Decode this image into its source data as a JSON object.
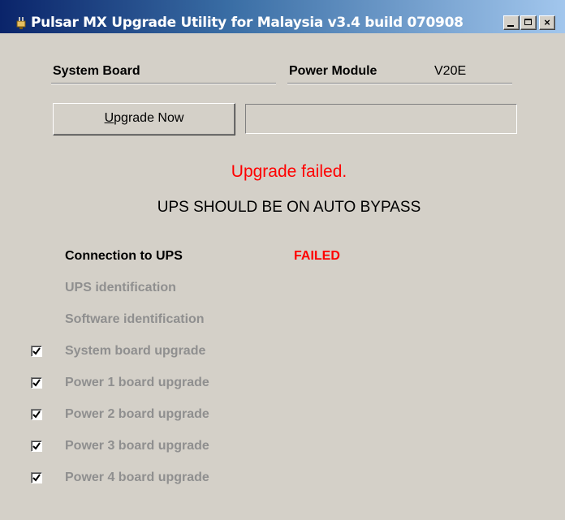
{
  "window": {
    "title": "Pulsar MX Upgrade Utility for Malaysia v3.4 build 070908"
  },
  "header": {
    "system_board_label": "System Board",
    "power_module_label": "Power Module",
    "power_module_value": "V20E"
  },
  "actions": {
    "upgrade_underline": "U",
    "upgrade_rest": "pgrade Now",
    "progress": 0
  },
  "status": {
    "result": "Upgrade failed.",
    "warning": "UPS SHOULD BE ON AUTO BYPASS"
  },
  "steps": [
    {
      "label": "Connection to UPS",
      "status": "FAILED",
      "active": true,
      "checkbox": false
    },
    {
      "label": "UPS identification",
      "active": false,
      "checkbox": false
    },
    {
      "label": "Software identification",
      "active": false,
      "checkbox": false
    },
    {
      "label": "System board upgrade",
      "active": false,
      "checkbox": true,
      "checked": true
    },
    {
      "label": "Power 1 board upgrade",
      "active": false,
      "checkbox": true,
      "checked": true
    },
    {
      "label": "Power 2 board upgrade",
      "active": false,
      "checkbox": true,
      "checked": true
    },
    {
      "label": "Power 3 board upgrade",
      "active": false,
      "checkbox": true,
      "checked": true
    },
    {
      "label": "Power 4 board upgrade",
      "active": false,
      "checkbox": true,
      "checked": true
    }
  ],
  "colors": {
    "error": "#ff0000",
    "disabled": "#8f8f8f",
    "face": "#d4d0c8",
    "title_start": "#0a246a",
    "title_end": "#a6caf0"
  }
}
